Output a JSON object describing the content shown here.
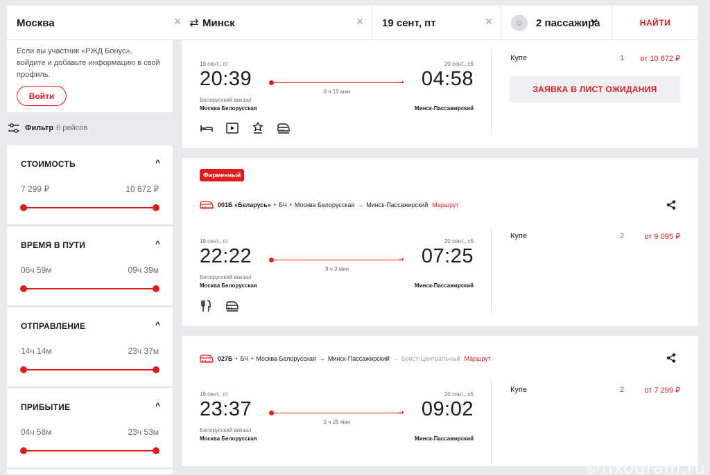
{
  "search": {
    "from": "Москва",
    "to": "Минск",
    "date": "19 сент, пт",
    "passengers": "2 пассажира",
    "find_label": "НАЙТИ",
    "clear_glyph": "×",
    "swap_glyph": "⇄",
    "chevron_glyph": "⌄",
    "avatar_glyph": "☺"
  },
  "bonus": {
    "text": "Если вы участник «РЖД Бонус», войдите и добавьте информацию в свой профиль.",
    "login_label": "Войти"
  },
  "filter": {
    "label": "Фильтр",
    "count": "6 рейсов"
  },
  "filters": [
    {
      "title": "СТОИМОСТЬ",
      "min": "7 299 ₽",
      "max": "10 672 ₽"
    },
    {
      "title": "ВРЕМЯ В ПУТИ",
      "min": "06ч 59м",
      "max": "09ч 39м"
    },
    {
      "title": "ОТПРАВЛЕНИЕ",
      "min": "14ч 14м",
      "max": "23ч 37м"
    },
    {
      "title": "ПРИБЫТИЕ",
      "min": "04ч 58м",
      "max": "23ч 53м"
    }
  ],
  "filter_caret": "^",
  "trains": [
    {
      "dep_date": "19 сент., пт",
      "dep_time": "20:39",
      "arr_date": "20 сент., сб",
      "arr_time": "04:58",
      "duration": "8 ч 19 мин",
      "station_note": "Белорусский вокзал",
      "dep_station": "Москва Белорусская",
      "arr_station": "Минск-Пассажирский",
      "fare": {
        "class": "Купе",
        "seats": "1",
        "price": "от 10 672 ₽"
      },
      "waitlist_label": "ЗАЯВКА В ЛИСТ ОЖИДАНИЯ",
      "amenities": [
        "bed-icon",
        "media-icon",
        "award-icon",
        "train-icon"
      ]
    },
    {
      "badge": "Фирменный",
      "number": "001Б",
      "name": "«Беларусь»",
      "carrier": "БЧ",
      "from": "Москва Белорусская",
      "to": "Минск-Пассажирский",
      "route_label": "Маршрут",
      "dep_date": "19 сент., пт",
      "dep_time": "22:22",
      "arr_date": "20 сент., сб",
      "arr_time": "07:25",
      "duration": "9 ч 3 мин",
      "station_note": "Белорусский вокзал",
      "dep_station": "Москва Белорусская",
      "arr_station": "Минск-Пассажирский",
      "fare": {
        "class": "Купе",
        "seats": "2",
        "price": "от 9 095 ₽"
      },
      "amenities": [
        "restaurant-icon",
        "train-icon"
      ]
    },
    {
      "number": "027Б",
      "carrier": "БЧ",
      "from": "Москва Белорусская",
      "to": "Минск-Пассажирский",
      "final": "Брест-Центральный",
      "route_label": "Маршрут",
      "dep_date": "19 сент., пт",
      "dep_time": "23:37",
      "arr_date": "20 сент., сб",
      "arr_time": "09:02",
      "duration": "9 ч 25 мин",
      "station_note": "Белорусский вокзал",
      "dep_station": "Москва Белорусская",
      "arr_station": "Минск-Пассажирский",
      "fare": {
        "class": "Купе",
        "seats": "2",
        "price": "от 7 299 ₽"
      }
    }
  ],
  "glyphs": {
    "dot": "•",
    "arrow": "→",
    "seg_arrow": "➝"
  },
  "watermark": "©fixogram.ru",
  "colors": {
    "accent": "#e21a1a",
    "background": "#e9eaee",
    "card": "#ffffff"
  }
}
